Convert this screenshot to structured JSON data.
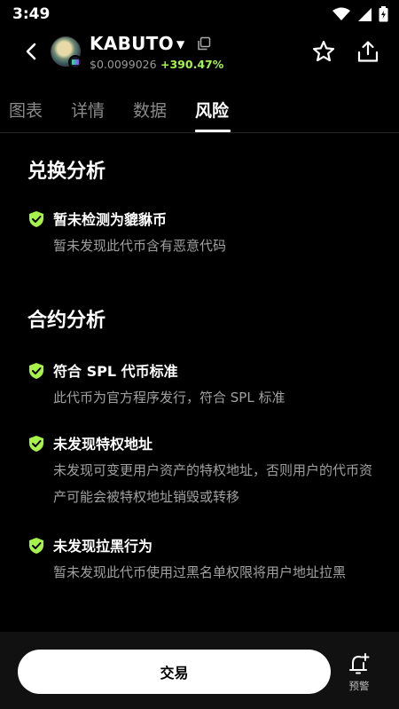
{
  "status_bar": {
    "time": "3:49"
  },
  "header": {
    "token_name": "KABUTO",
    "price": "$0.0099026",
    "change": "+390.47%",
    "change_color": "#a6f24a"
  },
  "tabs": [
    {
      "label": "图表"
    },
    {
      "label": "详情"
    },
    {
      "label": "数据"
    },
    {
      "label": "风险"
    }
  ],
  "active_tab": "风险",
  "sections": {
    "swap": {
      "title": "兑换分析",
      "items": [
        {
          "title": "暂未检测为貔貅币",
          "desc": "暂未发现此代币含有恶意代码"
        }
      ]
    },
    "contract": {
      "title": "合约分析",
      "items": [
        {
          "title": "符合 SPL 代币标准",
          "desc": "此代币为官方程序发行，符合 SPL 标准"
        },
        {
          "title": "未发现特权地址",
          "desc": "未发现可变更用户资产的特权地址，否则用户的代币资产可能会被特权地址销毁或转移"
        },
        {
          "title": "未发现拉黑行为",
          "desc": "暂未发现此代币使用过黑名单权限将用户地址拉黑"
        }
      ]
    }
  },
  "shield_color": "#a6f24a",
  "bottom_bar": {
    "trade_label": "交易",
    "alert_label": "预警"
  }
}
